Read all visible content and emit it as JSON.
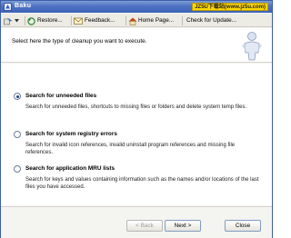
{
  "window": {
    "title": "Baku"
  },
  "watermark": "JZ5U下载站(www.jz5u.com)",
  "toolbar": {
    "restore_label": "Restore...",
    "feedback_label": "Feedback...",
    "homepage_label": "Home Page...",
    "check_update_label": "Check for Update..."
  },
  "header": {
    "instruction": "Select here the type of cleanup you want to execute."
  },
  "options": [
    {
      "label": "Search for unneeded files",
      "description": "Search for unneeded files, shortcuts to missing files or folders and delete system temp files.",
      "selected": true
    },
    {
      "label": "Search for system registry errors",
      "description": "Search for invalid icon references, invalid uninstall program references and missing file references.",
      "selected": false
    },
    {
      "label": "Search for application MRU lists",
      "description": "Search for keys and values containing information such as the names and/or locations of the last files you have accessed.",
      "selected": false
    }
  ],
  "buttons": {
    "back_label": "< Back",
    "next_label": "Next >",
    "close_label": "Close"
  },
  "colors": {
    "titlebar": "#4f72c3",
    "accent": "#1f3f85",
    "watermark_bg": "#ffd800"
  }
}
